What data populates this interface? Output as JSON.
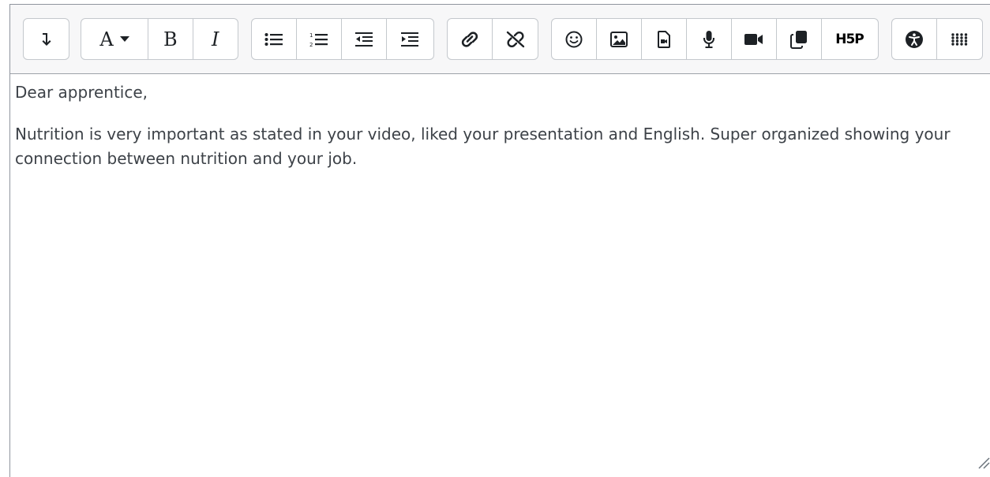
{
  "toolbar": {
    "groups": [
      {
        "buttons": [
          {
            "icon": "collapse-icon"
          }
        ]
      },
      {
        "buttons": [
          {
            "icon": "font-style-icon",
            "label": "A"
          },
          {
            "icon": "bold-icon",
            "label": "B"
          },
          {
            "icon": "italic-icon",
            "label": "I"
          }
        ]
      },
      {
        "buttons": [
          {
            "icon": "unordered-list-icon"
          },
          {
            "icon": "ordered-list-icon"
          },
          {
            "icon": "outdent-icon"
          },
          {
            "icon": "indent-icon"
          }
        ]
      },
      {
        "buttons": [
          {
            "icon": "link-icon"
          },
          {
            "icon": "unlink-icon"
          }
        ]
      },
      {
        "buttons": [
          {
            "icon": "emoji-icon"
          },
          {
            "icon": "image-icon"
          },
          {
            "icon": "media-file-icon"
          },
          {
            "icon": "microphone-icon"
          },
          {
            "icon": "video-camera-icon"
          },
          {
            "icon": "copy-icon"
          },
          {
            "icon": "h5p-icon",
            "label": "H5P"
          }
        ]
      },
      {
        "buttons": [
          {
            "icon": "accessibility-icon"
          },
          {
            "icon": "grid-icon"
          }
        ]
      }
    ]
  },
  "content": {
    "paragraphs": [
      "Dear apprentice,",
      "Nutrition is very important as stated in your video, liked your presentation and English. Super organized showing your connection between nutrition and your job."
    ]
  }
}
